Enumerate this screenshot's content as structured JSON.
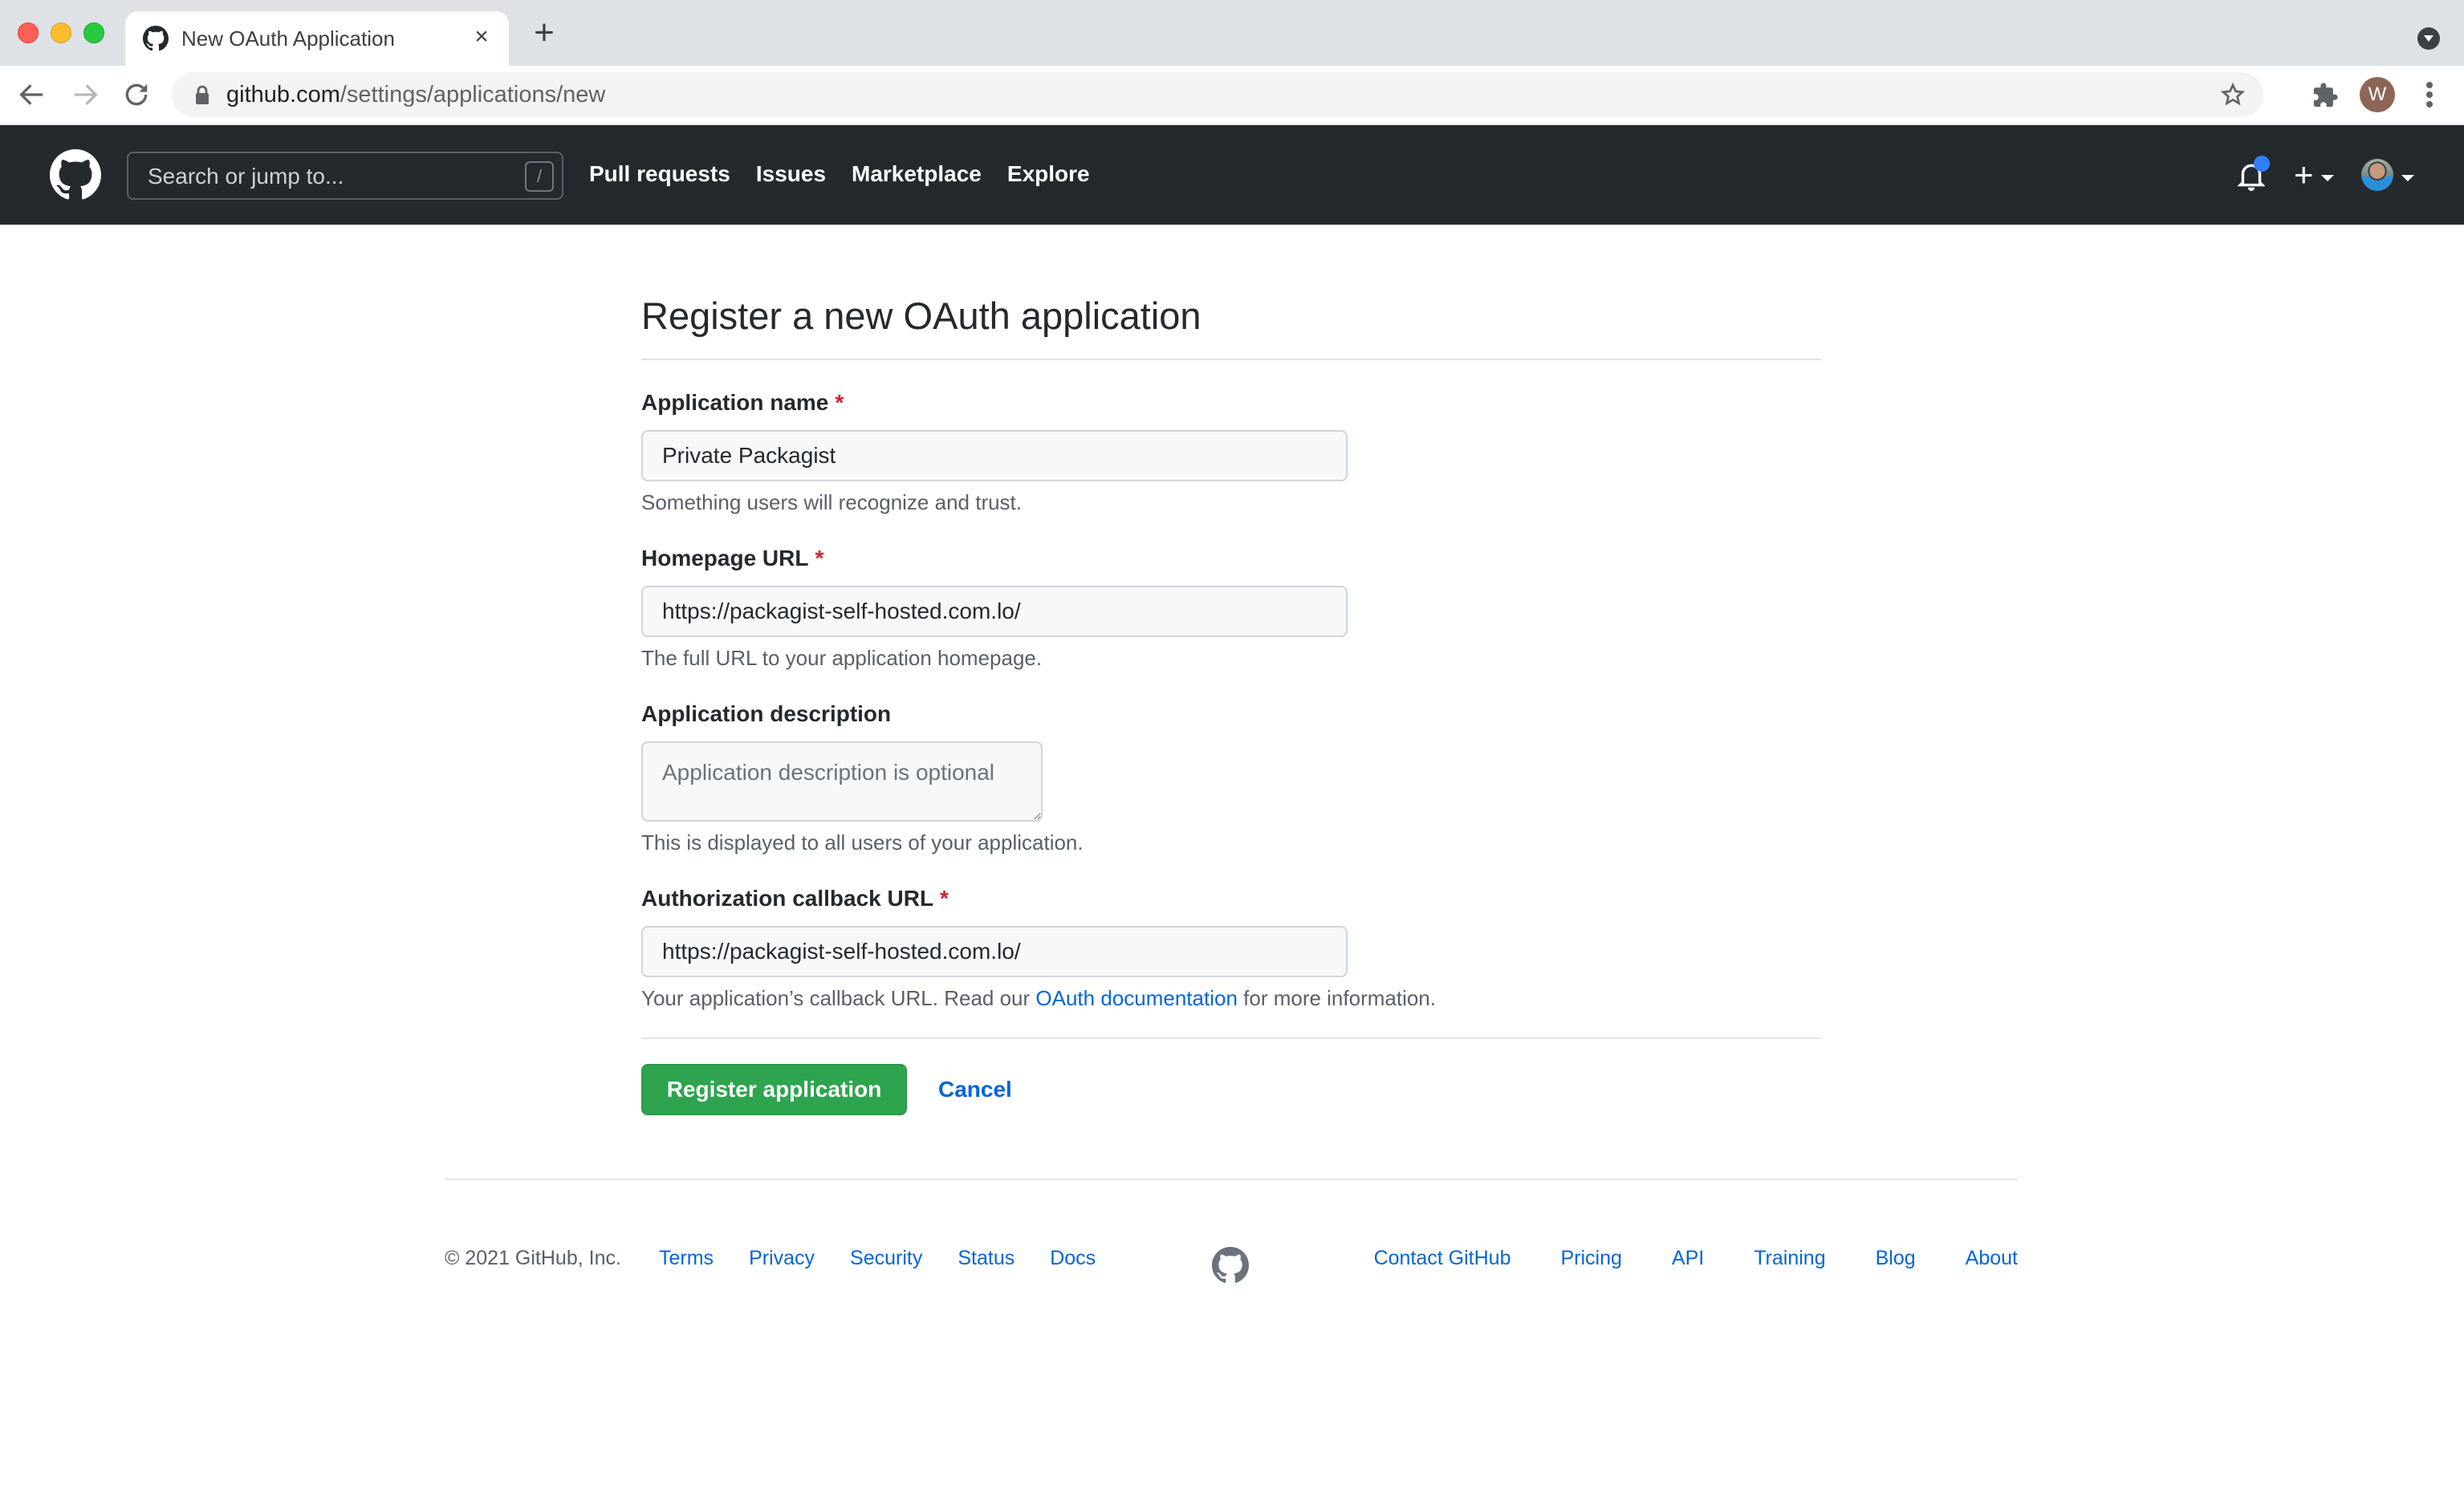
{
  "browser": {
    "tab_title": "New OAuth Application",
    "new_tab_label": "+",
    "tab_close_label": "×",
    "url_host": "github.com",
    "url_path": "/settings/applications/new",
    "profile_initial": "W"
  },
  "header": {
    "search_placeholder": "Search or jump to...",
    "search_shortcut": "/",
    "nav": [
      "Pull requests",
      "Issues",
      "Marketplace",
      "Explore"
    ],
    "plus_label": "+",
    "notification_dot_color": "#2f81f7"
  },
  "form": {
    "title": "Register a new OAuth application",
    "required_mark": "*",
    "fields": [
      {
        "label": "Application name",
        "required": true,
        "value": "Private Packagist",
        "note": "Something users will recognize and trust."
      },
      {
        "label": "Homepage URL",
        "required": true,
        "value": "https://packagist-self-hosted.com.lo/",
        "note": "The full URL to your application homepage."
      },
      {
        "label": "Application description",
        "required": false,
        "value": "",
        "placeholder": "Application description is optional",
        "note": "This is displayed to all users of your application."
      },
      {
        "label": "Authorization callback URL",
        "required": true,
        "value": "https://packagist-self-hosted.com.lo/",
        "note_before": "Your application’s callback URL. Read our ",
        "note_link": "OAuth documentation",
        "note_after": " for more information."
      }
    ],
    "submit_label": "Register application",
    "cancel_label": "Cancel",
    "primary_color": "#2ea44f",
    "link_color": "#0366d6"
  },
  "footer": {
    "copyright": "© 2021 GitHub, Inc.",
    "left_links": [
      "Terms",
      "Privacy",
      "Security",
      "Status",
      "Docs"
    ],
    "right_links": [
      "Contact GitHub",
      "Pricing",
      "API",
      "Training",
      "Blog",
      "About"
    ]
  }
}
